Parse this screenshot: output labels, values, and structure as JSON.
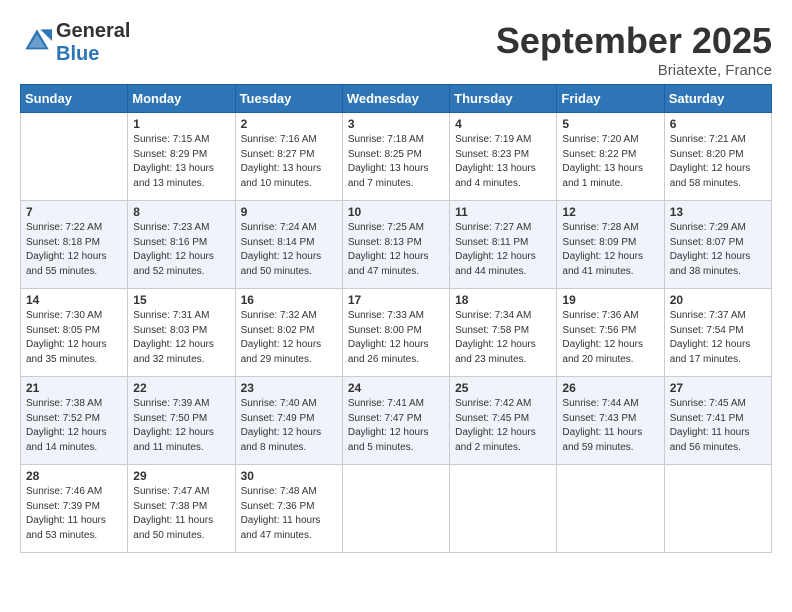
{
  "header": {
    "logo_general": "General",
    "logo_blue": "Blue",
    "month_title": "September 2025",
    "location": "Briatexte, France"
  },
  "days_of_week": [
    "Sunday",
    "Monday",
    "Tuesday",
    "Wednesday",
    "Thursday",
    "Friday",
    "Saturday"
  ],
  "weeks": [
    [
      {
        "num": "",
        "info": ""
      },
      {
        "num": "1",
        "info": "Sunrise: 7:15 AM\nSunset: 8:29 PM\nDaylight: 13 hours\nand 13 minutes."
      },
      {
        "num": "2",
        "info": "Sunrise: 7:16 AM\nSunset: 8:27 PM\nDaylight: 13 hours\nand 10 minutes."
      },
      {
        "num": "3",
        "info": "Sunrise: 7:18 AM\nSunset: 8:25 PM\nDaylight: 13 hours\nand 7 minutes."
      },
      {
        "num": "4",
        "info": "Sunrise: 7:19 AM\nSunset: 8:23 PM\nDaylight: 13 hours\nand 4 minutes."
      },
      {
        "num": "5",
        "info": "Sunrise: 7:20 AM\nSunset: 8:22 PM\nDaylight: 13 hours\nand 1 minute."
      },
      {
        "num": "6",
        "info": "Sunrise: 7:21 AM\nSunset: 8:20 PM\nDaylight: 12 hours\nand 58 minutes."
      }
    ],
    [
      {
        "num": "7",
        "info": "Sunrise: 7:22 AM\nSunset: 8:18 PM\nDaylight: 12 hours\nand 55 minutes."
      },
      {
        "num": "8",
        "info": "Sunrise: 7:23 AM\nSunset: 8:16 PM\nDaylight: 12 hours\nand 52 minutes."
      },
      {
        "num": "9",
        "info": "Sunrise: 7:24 AM\nSunset: 8:14 PM\nDaylight: 12 hours\nand 50 minutes."
      },
      {
        "num": "10",
        "info": "Sunrise: 7:25 AM\nSunset: 8:13 PM\nDaylight: 12 hours\nand 47 minutes."
      },
      {
        "num": "11",
        "info": "Sunrise: 7:27 AM\nSunset: 8:11 PM\nDaylight: 12 hours\nand 44 minutes."
      },
      {
        "num": "12",
        "info": "Sunrise: 7:28 AM\nSunset: 8:09 PM\nDaylight: 12 hours\nand 41 minutes."
      },
      {
        "num": "13",
        "info": "Sunrise: 7:29 AM\nSunset: 8:07 PM\nDaylight: 12 hours\nand 38 minutes."
      }
    ],
    [
      {
        "num": "14",
        "info": "Sunrise: 7:30 AM\nSunset: 8:05 PM\nDaylight: 12 hours\nand 35 minutes."
      },
      {
        "num": "15",
        "info": "Sunrise: 7:31 AM\nSunset: 8:03 PM\nDaylight: 12 hours\nand 32 minutes."
      },
      {
        "num": "16",
        "info": "Sunrise: 7:32 AM\nSunset: 8:02 PM\nDaylight: 12 hours\nand 29 minutes."
      },
      {
        "num": "17",
        "info": "Sunrise: 7:33 AM\nSunset: 8:00 PM\nDaylight: 12 hours\nand 26 minutes."
      },
      {
        "num": "18",
        "info": "Sunrise: 7:34 AM\nSunset: 7:58 PM\nDaylight: 12 hours\nand 23 minutes."
      },
      {
        "num": "19",
        "info": "Sunrise: 7:36 AM\nSunset: 7:56 PM\nDaylight: 12 hours\nand 20 minutes."
      },
      {
        "num": "20",
        "info": "Sunrise: 7:37 AM\nSunset: 7:54 PM\nDaylight: 12 hours\nand 17 minutes."
      }
    ],
    [
      {
        "num": "21",
        "info": "Sunrise: 7:38 AM\nSunset: 7:52 PM\nDaylight: 12 hours\nand 14 minutes."
      },
      {
        "num": "22",
        "info": "Sunrise: 7:39 AM\nSunset: 7:50 PM\nDaylight: 12 hours\nand 11 minutes."
      },
      {
        "num": "23",
        "info": "Sunrise: 7:40 AM\nSunset: 7:49 PM\nDaylight: 12 hours\nand 8 minutes."
      },
      {
        "num": "24",
        "info": "Sunrise: 7:41 AM\nSunset: 7:47 PM\nDaylight: 12 hours\nand 5 minutes."
      },
      {
        "num": "25",
        "info": "Sunrise: 7:42 AM\nSunset: 7:45 PM\nDaylight: 12 hours\nand 2 minutes."
      },
      {
        "num": "26",
        "info": "Sunrise: 7:44 AM\nSunset: 7:43 PM\nDaylight: 11 hours\nand 59 minutes."
      },
      {
        "num": "27",
        "info": "Sunrise: 7:45 AM\nSunset: 7:41 PM\nDaylight: 11 hours\nand 56 minutes."
      }
    ],
    [
      {
        "num": "28",
        "info": "Sunrise: 7:46 AM\nSunset: 7:39 PM\nDaylight: 11 hours\nand 53 minutes."
      },
      {
        "num": "29",
        "info": "Sunrise: 7:47 AM\nSunset: 7:38 PM\nDaylight: 11 hours\nand 50 minutes."
      },
      {
        "num": "30",
        "info": "Sunrise: 7:48 AM\nSunset: 7:36 PM\nDaylight: 11 hours\nand 47 minutes."
      },
      {
        "num": "",
        "info": ""
      },
      {
        "num": "",
        "info": ""
      },
      {
        "num": "",
        "info": ""
      },
      {
        "num": "",
        "info": ""
      }
    ]
  ]
}
